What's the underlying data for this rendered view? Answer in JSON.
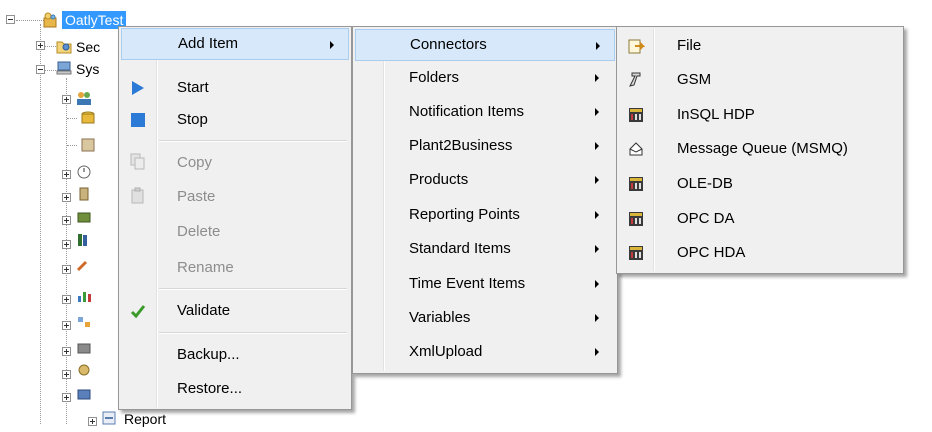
{
  "tree": {
    "root": "OatlyTest",
    "child1": "Sec",
    "child2": "Sys",
    "last": "Report"
  },
  "context_menu": {
    "add_item": "Add Item",
    "start": "Start",
    "stop": "Stop",
    "copy": "Copy",
    "paste": "Paste",
    "delete": "Delete",
    "rename": "Rename",
    "validate": "Validate",
    "backup": "Backup...",
    "restore": "Restore..."
  },
  "add_item_menu": {
    "items": [
      "Connectors",
      "Folders",
      "Notification Items",
      "Plant2Business",
      "Products",
      "Reporting Points",
      "Standard Items",
      "Time Event Items",
      "Variables",
      "XmlUpload"
    ]
  },
  "connectors_menu": {
    "items": [
      "File",
      "GSM",
      "InSQL HDP",
      "Message Queue (MSMQ)",
      "OLE-DB",
      "OPC DA",
      "OPC HDA"
    ]
  },
  "colors": {
    "selection": "#3399ff",
    "menu_bg": "#f0f0f0",
    "highlight": "#d6e8fa",
    "disabled_text": "#8d8d8d"
  }
}
